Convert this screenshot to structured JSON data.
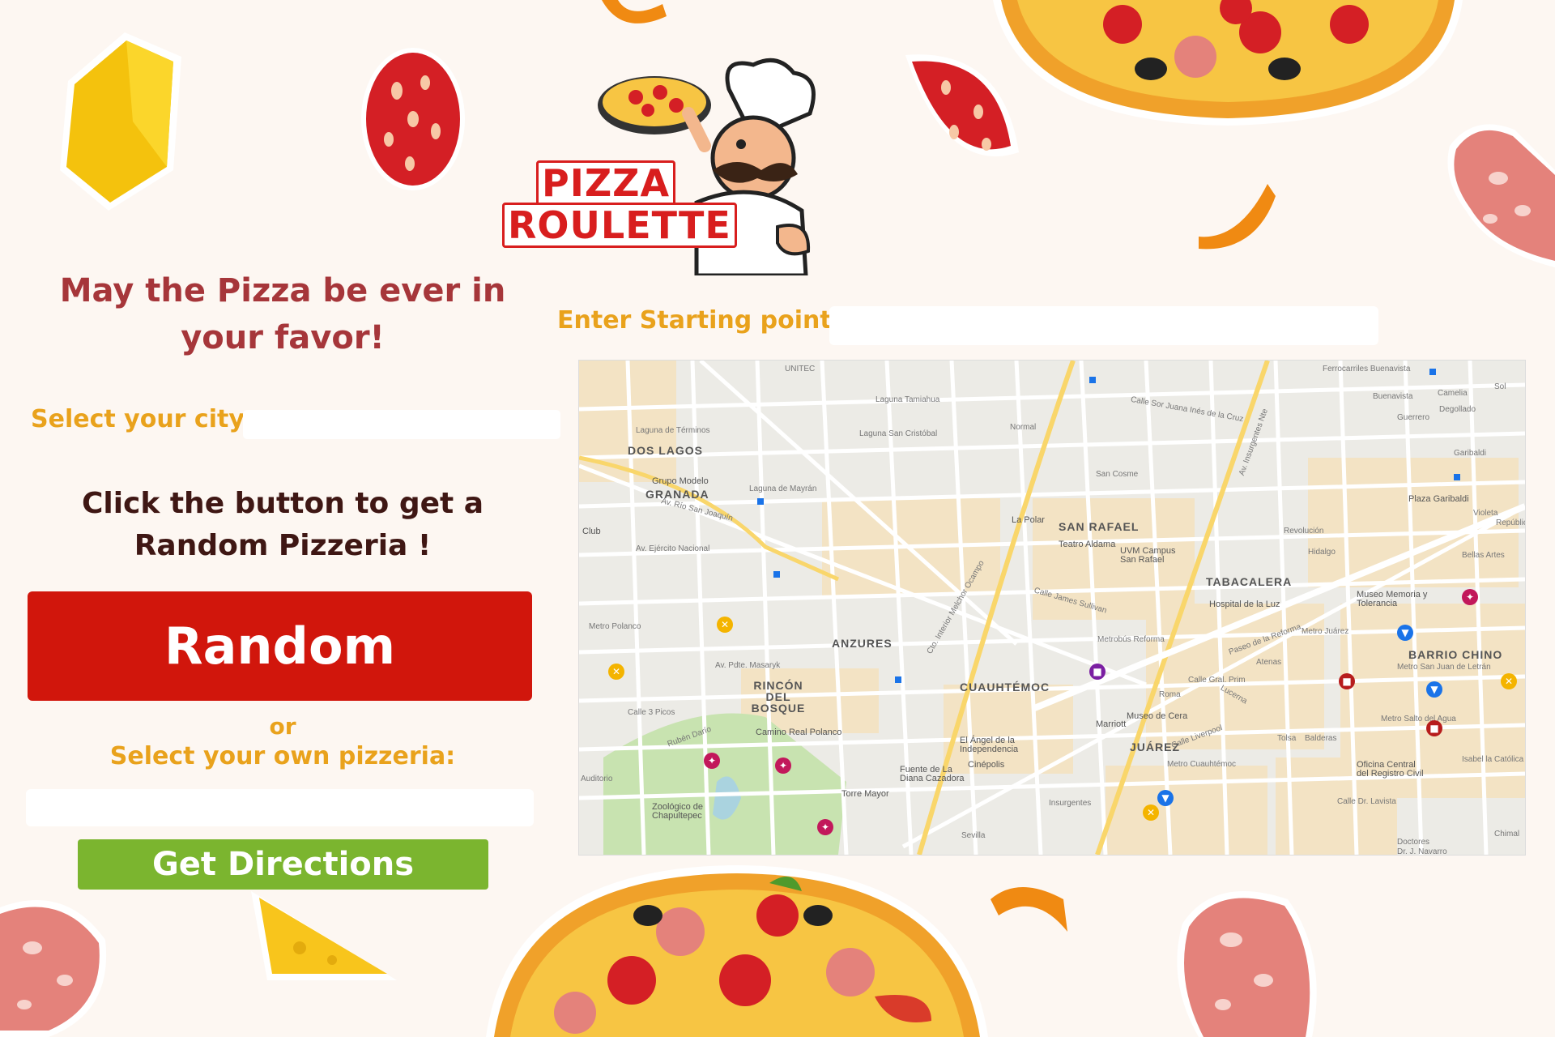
{
  "brand": {
    "logo_line1": "PIZZA",
    "logo_line2": "ROULETTE",
    "colors": {
      "brand_red": "#d1160c",
      "accent_orange": "#e9a21c",
      "title_maroon": "#a6363a",
      "go_green": "#7bb52f"
    }
  },
  "hero": {
    "tagline": "May the Pizza be ever in your favor!"
  },
  "city": {
    "label": "Select your city:",
    "value": ""
  },
  "random_section": {
    "instruction": "Click the button to get a Random Pizzeria !",
    "button_label": "Random",
    "or_text": "or",
    "own_label": "Select your own pizzeria:",
    "pizzeria_value": ""
  },
  "directions": {
    "button_label": "Get Directions"
  },
  "start": {
    "label": "Enter Starting point:",
    "value": ""
  },
  "map": {
    "areas": [
      "DOS LAGOS",
      "GRANADA",
      "SAN RAFAEL",
      "TABACALERA",
      "ANZURES",
      "RINCÓN DEL BOSQUE",
      "CUAUHTÉMOC",
      "JUÁREZ",
      "BARRIO CHINO"
    ],
    "places": [
      "Grupo Modelo",
      "Teatro Aldama",
      "UVM Campus San Rafael",
      "Hospital de la Luz",
      "Museo Memoria y Tolerancia",
      "Plaza Garibaldi",
      "Camino Real Polanco",
      "Zoológico de Chapultepec",
      "Torre Mayor",
      "Fuente de La Diana Cazadora",
      "El Ángel de la Independencia",
      "Cinépolis",
      "Marriott",
      "Museo de Cera",
      "Oficina Central del Registro Civil",
      "La Polar",
      "Club"
    ],
    "streets": [
      "Av. Río San Joaquín",
      "Av. Ejército Nacional",
      "Av. Pdte. Masaryk",
      "Calle 3 Picos",
      "Rubén Darío",
      "Cto. Interior Melchor Ocampo",
      "Av. Insurgentes Nte",
      "Calle James Sullivan",
      "Paseo de la Reforma",
      "Laguna de Términos",
      "Laguna de Mayrán",
      "Laguna Tamiahua",
      "Laguna San Cristóbal",
      "Calle Sor Juana Inés de la Cruz",
      "Ferrocarriles Buenavista",
      "Buenavista",
      "Guerrero",
      "Garibaldi",
      "Revolución",
      "Hidalgo",
      "Bellas Artes",
      "Metro Juárez",
      "Metro Cuauhtémoc",
      "Insurgentes",
      "Sevilla",
      "Doctores",
      "Metro Polanco",
      "Auditorio",
      "Normal",
      "San Cosme",
      "Metrobús Reforma",
      "Metro Salto del Agua",
      "Isabel la Católica",
      "Balderas",
      "Metro San Juan de Letrán",
      "Calle Dr. Lavista",
      "Atenas",
      "Roma",
      "Lucerna",
      "Calle Liverpool",
      "Calle Gral. Prim",
      "Violeta",
      "Camelia",
      "Degollado",
      "República",
      "Chimal",
      "Sol",
      "Dr. J. Navarro",
      "UNITEC",
      "Tolsa"
    ]
  }
}
